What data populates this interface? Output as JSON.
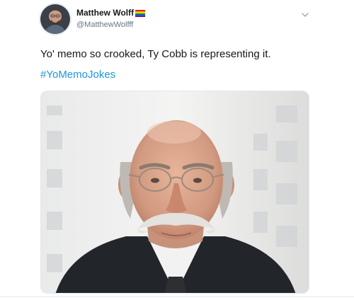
{
  "tweet": {
    "display_name": "Matthew Wolff",
    "handle": "@MatthewWolfff",
    "text": "Yo' memo so crooked, Ty Cobb is representing it.",
    "hashtag": "#YoMemoJokes"
  },
  "icons": {
    "flag": "rainbow-flag-icon",
    "menu": "chevron-down-icon"
  },
  "colors": {
    "name": "#14171a",
    "handle": "#657786",
    "link": "#1b95e0",
    "border": "#e1e8ed"
  }
}
